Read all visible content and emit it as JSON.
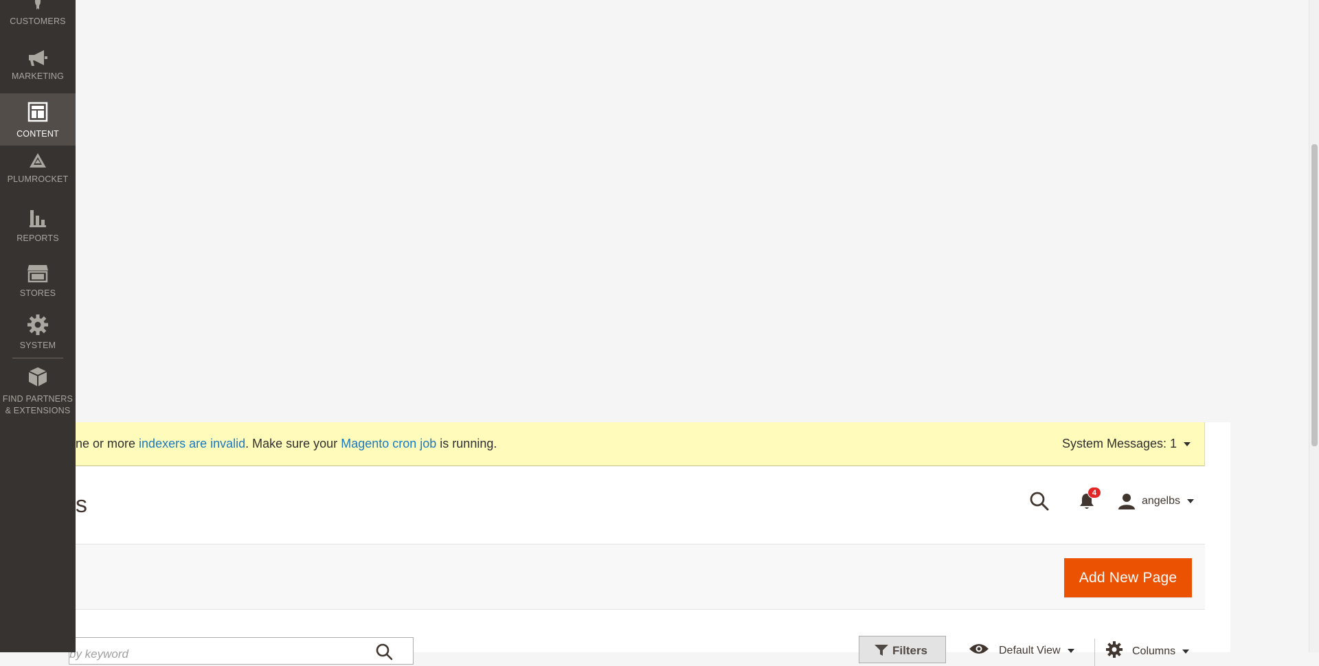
{
  "sidebar": {
    "items": [
      {
        "label": "CUSTOMERS",
        "icon": "customers-icon"
      },
      {
        "label": "MARKETING",
        "icon": "megaphone-icon"
      },
      {
        "label": "CONTENT",
        "icon": "layout-icon",
        "active": true
      },
      {
        "label": "PLUMROCKET",
        "icon": "plumrocket-icon"
      },
      {
        "label": "REPORTS",
        "icon": "bar-chart-icon"
      },
      {
        "label": "STORES",
        "icon": "storefront-icon"
      },
      {
        "label": "SYSTEM",
        "icon": "gear-icon"
      },
      {
        "label_line1": "FIND PARTNERS",
        "label_line2": "& EXTENSIONS",
        "icon": "cube-icon"
      }
    ]
  },
  "system_message": {
    "prefix": "ne or more ",
    "link1": "indexers are invalid",
    "middle": ". Make sure your ",
    "link2": "Magento cron job",
    "suffix": " is running.",
    "count_label": "System Messages: 1"
  },
  "header": {
    "title_fragment": "s",
    "notification_count": "4",
    "username": "angelbs"
  },
  "actions": {
    "add_new_label": "Add New Page"
  },
  "toolbar": {
    "search_value": "by keyword",
    "filters_label": "Filters",
    "view_label": "Default View",
    "columns_label": "Columns"
  },
  "colors": {
    "sidebar_bg": "#373330",
    "accent": "#eb5202",
    "link": "#1979c3",
    "message_bg": "#fffbbb"
  }
}
